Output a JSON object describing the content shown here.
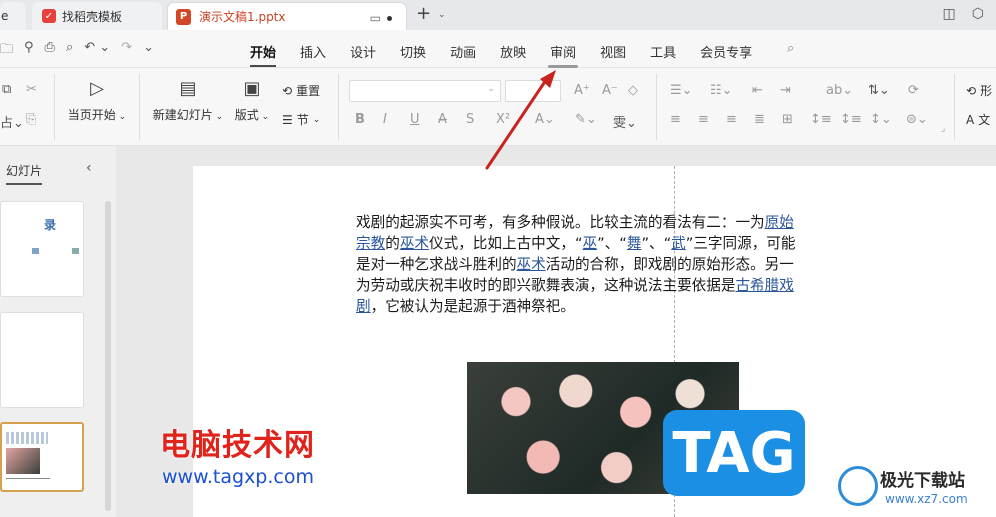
{
  "tabs": {
    "partial_label": "e",
    "template_label": "找稻壳模板",
    "doc_label": "演示文稿1.pptx"
  },
  "menu": {
    "items": [
      "开始",
      "插入",
      "设计",
      "切换",
      "动画",
      "放映",
      "审阅",
      "视图",
      "工具",
      "会员专享"
    ],
    "active": "开始",
    "highlighted": "审阅"
  },
  "ribbon": {
    "from_start": "当页开始",
    "new_slide": "新建幻灯片",
    "layout": "版式",
    "reset": "重置",
    "section": "节",
    "right_clipped_1": "形",
    "right_clipped_2": "文"
  },
  "left_panel": {
    "title": "幻灯片",
    "thumb1_text": "录"
  },
  "slide": {
    "text_parts": [
      {
        "t": "戏剧的起源实不可考，有多种假说。比较主流的看法有二：一为",
        "link": false
      },
      {
        "t": "原始宗教",
        "link": true
      },
      {
        "t": "的",
        "link": false
      },
      {
        "t": "巫术",
        "link": true
      },
      {
        "t": "仪式，比如上古中文，“",
        "link": false
      },
      {
        "t": "巫",
        "link": true
      },
      {
        "t": "”、“",
        "link": false
      },
      {
        "t": "舞",
        "link": true
      },
      {
        "t": "”、“",
        "link": false
      },
      {
        "t": "武",
        "link": true
      },
      {
        "t": "”三字同源，可能是对一种乞求战斗胜利的",
        "link": false
      },
      {
        "t": "巫术",
        "link": true
      },
      {
        "t": "活动的合称，即戏剧的原始形态。另一为劳动或庆祝丰收时的即兴歌舞表演，这种说法主要依据是",
        "link": false
      },
      {
        "t": "古希腊戏剧",
        "link": true
      },
      {
        "t": "，它被认为是起源于酒神祭祀。",
        "link": false
      }
    ]
  },
  "watermark": {
    "red_text": "电脑技术网",
    "url_text": "www.tagxp.com",
    "tag_text": "TAG",
    "site_name": "极光下载站",
    "site_url": "www.xz7.com"
  },
  "colors": {
    "link": "#2b579a",
    "annotation_arrow": "#c8231f",
    "tag_badge": "#1a8fe3"
  },
  "icons": [
    "undo-icon",
    "redo-icon",
    "print-icon",
    "print-preview-icon",
    "play-icon",
    "new-slide-icon",
    "layout-icon",
    "reset-icon",
    "section-icon",
    "bold-icon",
    "italic-icon",
    "underline-icon",
    "strikethrough-icon",
    "search-icon",
    "collapse-panel-icon"
  ]
}
